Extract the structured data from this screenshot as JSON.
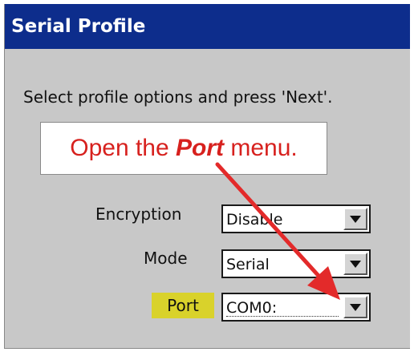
{
  "window": {
    "title": "Serial Profile"
  },
  "instruction": "Select profile options and press 'Next'.",
  "callout": {
    "prefix": "Open the ",
    "emphasis": "Port",
    "suffix": " menu."
  },
  "fields": {
    "encryption": {
      "label": "Encryption",
      "value": "Disable"
    },
    "mode": {
      "label": "Mode",
      "value": "Serial"
    },
    "port": {
      "label": "Port",
      "value": "COM0:"
    }
  },
  "colors": {
    "titlebar": "#0d2d8c",
    "callout_text": "#d7211e",
    "arrow": "#e32a2a",
    "highlight": "#d9d22b"
  },
  "icons": {
    "dropdown": "chevron-down-icon",
    "arrow": "arrow-icon"
  }
}
